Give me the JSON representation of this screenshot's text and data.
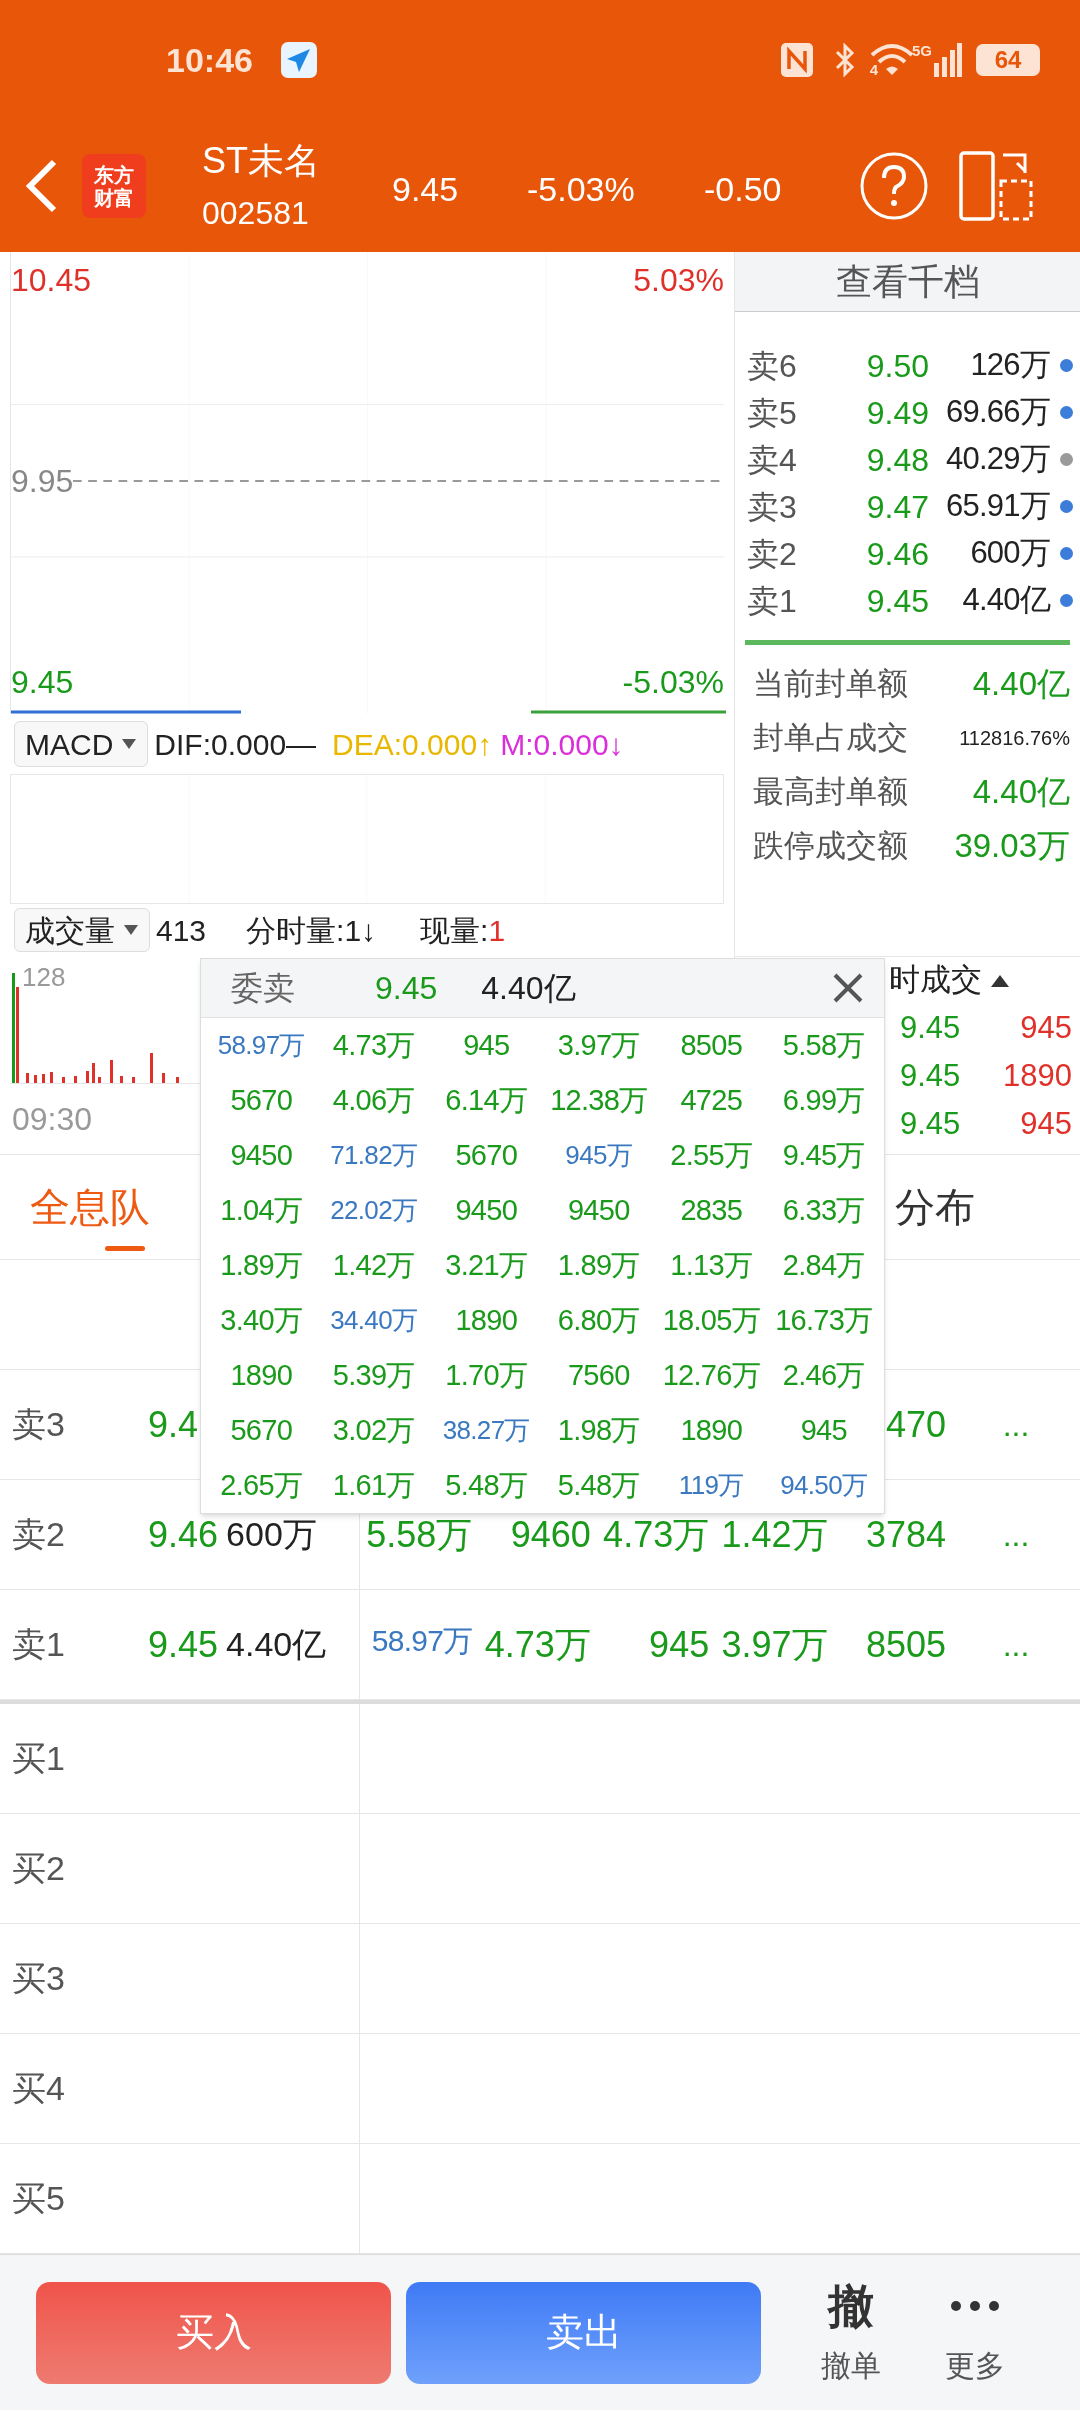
{
  "status_bar": {
    "time": "10:46",
    "wifi_band": "4",
    "network": "5G",
    "battery": "64"
  },
  "header": {
    "logo": [
      "东方",
      "财富"
    ],
    "name": "ST未名",
    "code": "002581",
    "price": "9.45",
    "change_pct": "-5.03%",
    "change": "-0.50"
  },
  "chart": {
    "high": "10.45",
    "high_pct": "5.03%",
    "mid": "9.95",
    "low": "9.45",
    "low_pct": "-5.03%"
  },
  "macd": {
    "selector": "MACD",
    "dif": "DIF:0.000—",
    "dea": "DEA:0.000↑",
    "m": "M:0.000↓"
  },
  "volume": {
    "selector": "成交量",
    "value": "413",
    "fenshi": "分时量:1↓",
    "xianliang_label": "现量:",
    "xianliang_value": "1",
    "scale": "128",
    "start_time": "09:30"
  },
  "order_book": {
    "button": "查看千档",
    "asks": [
      {
        "label": "卖6",
        "price": "9.50",
        "volume": "126万",
        "color": "#3b7dd8"
      },
      {
        "label": "卖5",
        "price": "9.49",
        "volume": "69.66万",
        "color": "#3b7dd8"
      },
      {
        "label": "卖4",
        "price": "9.48",
        "volume": "40.29万",
        "color": "#9a9a9a"
      },
      {
        "label": "卖3",
        "price": "9.47",
        "volume": "65.91万",
        "color": "#3b7dd8"
      },
      {
        "label": "卖2",
        "price": "9.46",
        "volume": "600万",
        "color": "#3b7dd8"
      },
      {
        "label": "卖1",
        "price": "9.45",
        "volume": "4.40亿",
        "color": "#3b7dd8"
      }
    ],
    "stats": [
      {
        "label": "当前封单额",
        "value": "4.40亿",
        "kind": "big"
      },
      {
        "label": "封单占成交",
        "value": "112816.76%",
        "kind": "small"
      },
      {
        "label": "最高封单额",
        "value": "4.40亿",
        "kind": "big"
      },
      {
        "label": "跌停成交额",
        "value": "39.03万",
        "kind": "big"
      }
    ]
  },
  "trades": {
    "title": "时成交",
    "rows": [
      {
        "price": "9.45",
        "volume": "945"
      },
      {
        "price": "9.45",
        "volume": "1890"
      },
      {
        "price": "9.45",
        "volume": "945"
      }
    ]
  },
  "tabs": [
    {
      "label": "全息队",
      "selected": true
    },
    {
      "label": "分布",
      "selected": false
    }
  ],
  "queue_table": {
    "rows": [
      {
        "label": "卖3",
        "price": "9.4",
        "queue": [
          {
            "value": "470",
            "big": false
          }
        ],
        "more": "..."
      },
      {
        "label": "卖2",
        "price": "9.46",
        "volume": "600万",
        "queue": [
          {
            "value": "5.58万",
            "big": false
          },
          {
            "value": "9460",
            "big": false
          },
          {
            "value": "4.73万",
            "big": false
          },
          {
            "value": "1.42万",
            "big": false
          },
          {
            "value": "3784",
            "big": false
          }
        ],
        "more": "..."
      },
      {
        "label": "卖1",
        "price": "9.45",
        "volume": "4.40亿",
        "queue": [
          {
            "value": "58.97万",
            "big": true
          },
          {
            "value": "4.73万",
            "big": false
          },
          {
            "value": "945",
            "big": false
          },
          {
            "value": "3.97万",
            "big": false
          },
          {
            "value": "8505",
            "big": false
          }
        ],
        "more": "..."
      },
      {
        "label": "买1"
      },
      {
        "label": "买2"
      },
      {
        "label": "买3"
      },
      {
        "label": "买4"
      },
      {
        "label": "买5"
      }
    ]
  },
  "popup": {
    "title": "委卖",
    "price": "9.45",
    "volume": "4.40亿",
    "rows": [
      [
        {
          "value": "58.97万",
          "big": true
        },
        {
          "value": "4.73万",
          "big": false
        },
        {
          "value": "945",
          "big": false
        },
        {
          "value": "3.97万",
          "big": false
        },
        {
          "value": "8505",
          "big": false
        },
        {
          "value": "5.58万",
          "big": false
        }
      ],
      [
        {
          "value": "5670",
          "big": false
        },
        {
          "value": "4.06万",
          "big": false
        },
        {
          "value": "6.14万",
          "big": false
        },
        {
          "value": "12.38万",
          "big": false
        },
        {
          "value": "4725",
          "big": false
        },
        {
          "value": "6.99万",
          "big": false
        }
      ],
      [
        {
          "value": "9450",
          "big": false
        },
        {
          "value": "71.82万",
          "big": true
        },
        {
          "value": "5670",
          "big": false
        },
        {
          "value": "945万",
          "big": true
        },
        {
          "value": "2.55万",
          "big": false
        },
        {
          "value": "9.45万",
          "big": false
        }
      ],
      [
        {
          "value": "1.04万",
          "big": false
        },
        {
          "value": "22.02万",
          "big": true
        },
        {
          "value": "9450",
          "big": false
        },
        {
          "value": "9450",
          "big": false
        },
        {
          "value": "2835",
          "big": false
        },
        {
          "value": "6.33万",
          "big": false
        }
      ],
      [
        {
          "value": "1.89万",
          "big": false
        },
        {
          "value": "1.42万",
          "big": false
        },
        {
          "value": "3.21万",
          "big": false
        },
        {
          "value": "1.89万",
          "big": false
        },
        {
          "value": "1.13万",
          "big": false
        },
        {
          "value": "2.84万",
          "big": false
        }
      ],
      [
        {
          "value": "3.40万",
          "big": false
        },
        {
          "value": "34.40万",
          "big": true
        },
        {
          "value": "1890",
          "big": false
        },
        {
          "value": "6.80万",
          "big": false
        },
        {
          "value": "18.05万",
          "big": false
        },
        {
          "value": "16.73万",
          "big": false
        }
      ],
      [
        {
          "value": "1890",
          "big": false
        },
        {
          "value": "5.39万",
          "big": false
        },
        {
          "value": "1.70万",
          "big": false
        },
        {
          "value": "7560",
          "big": false
        },
        {
          "value": "12.76万",
          "big": false
        },
        {
          "value": "2.46万",
          "big": false
        }
      ],
      [
        {
          "value": "5670",
          "big": false
        },
        {
          "value": "3.02万",
          "big": false
        },
        {
          "value": "38.27万",
          "big": true
        },
        {
          "value": "1.98万",
          "big": false
        },
        {
          "value": "1890",
          "big": false
        },
        {
          "value": "945",
          "big": false
        }
      ],
      [
        {
          "value": "2.65万",
          "big": false
        },
        {
          "value": "1.61万",
          "big": false
        },
        {
          "value": "5.48万",
          "big": false
        },
        {
          "value": "5.48万",
          "big": false
        },
        {
          "value": "119万",
          "big": true
        },
        {
          "value": "94.50万",
          "big": true
        }
      ]
    ]
  },
  "actions": {
    "buy": "买入",
    "sell": "卖出",
    "cancel_glyph": "撤",
    "cancel": "撤单",
    "more": "更多"
  }
}
